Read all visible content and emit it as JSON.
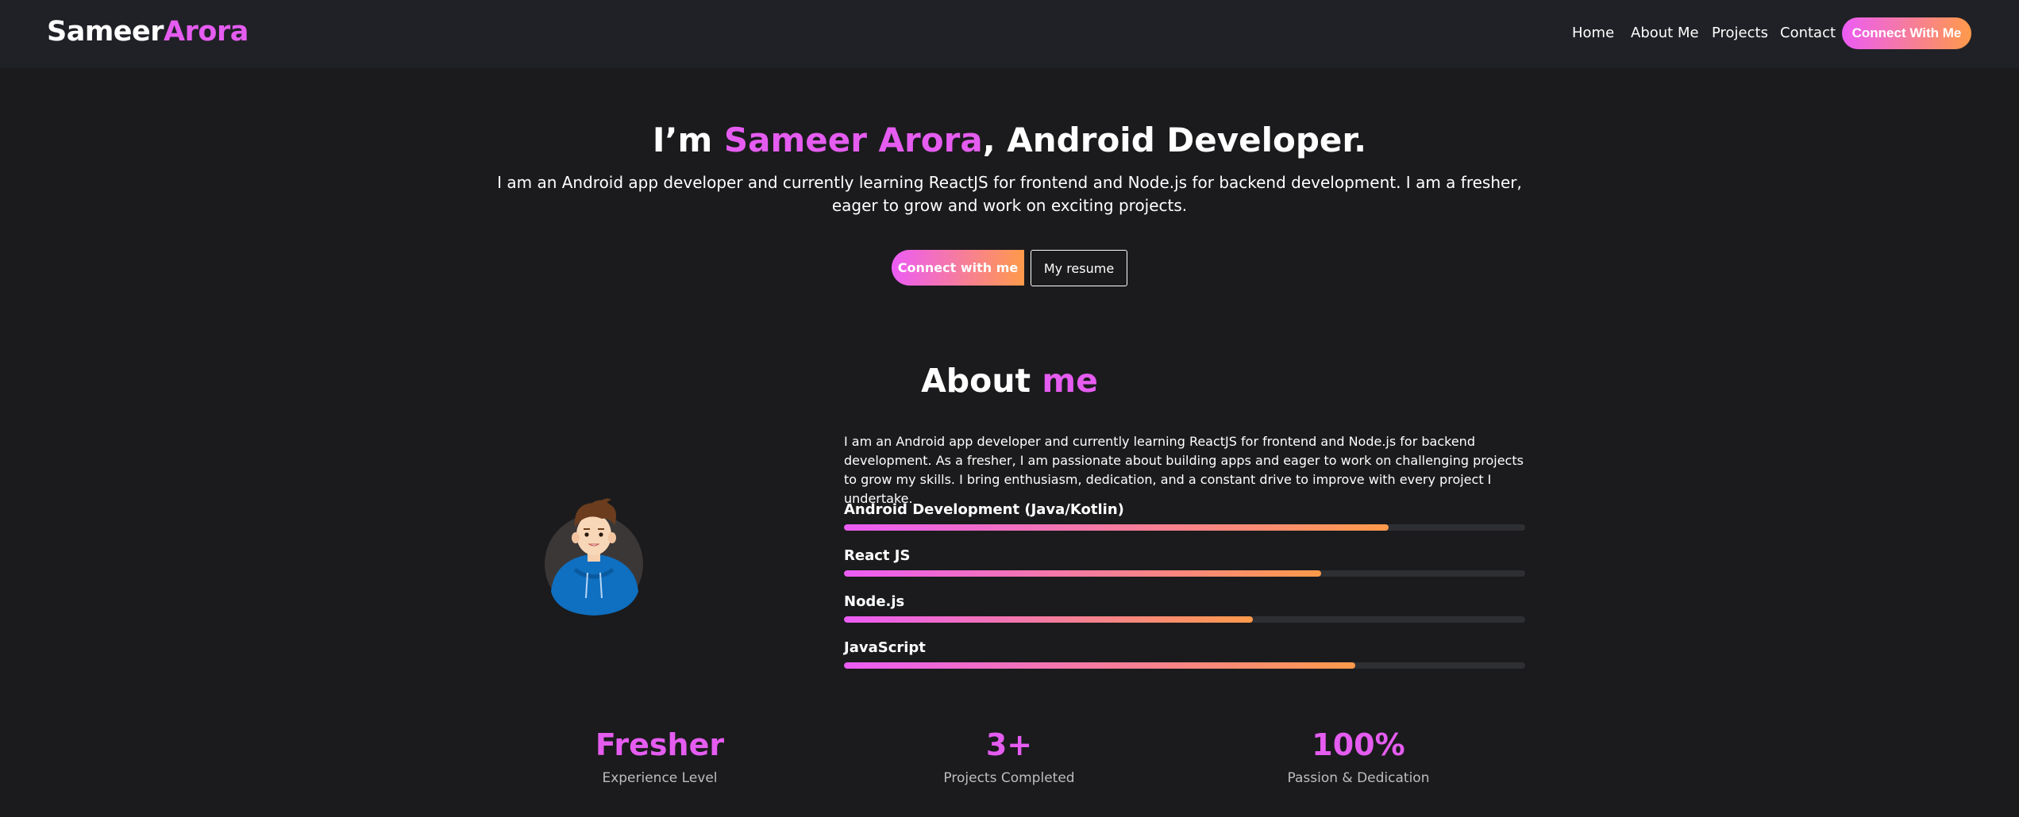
{
  "nav": {
    "logo_first": "Sameer",
    "logo_last": "Arora",
    "links": [
      "Home",
      "About Me",
      "Projects",
      "Contact"
    ],
    "cta_label": "Connect With Me"
  },
  "hero": {
    "title_prefix": "I’m ",
    "title_name": "Sameer Arora",
    "title_suffix": ", Android Developer.",
    "description": "I am an Android app developer and currently learning ReactJS for frontend and Node.js for backend development. I am a fresher, eager to grow and work on exciting projects.",
    "primary_button": "Connect with me",
    "secondary_button": "My resume"
  },
  "about": {
    "title_prefix": "About ",
    "title_accent": "me",
    "description": "I am an Android app developer and currently learning ReactJS for frontend and Node.js for backend development. As a fresher, I am passionate about building apps and eager to work on challenging projects to grow my skills. I bring enthusiasm, dedication, and a constant drive to improve with every project I undertake.",
    "skills": [
      {
        "name": "Android Development (Java/Kotlin)",
        "level": 0.8
      },
      {
        "name": "React JS",
        "level": 0.7
      },
      {
        "name": "Node.js",
        "level": 0.6
      },
      {
        "name": "JavaScript",
        "level": 0.75
      }
    ]
  },
  "stats": [
    {
      "value": "Fresher",
      "label": "Experience Level"
    },
    {
      "value": "3+",
      "label": "Projects Completed"
    },
    {
      "value": "100%",
      "label": "Passion & Dedication"
    }
  ],
  "colors": {
    "accent": "#e55cf0",
    "gradient_start": "#ec5cf5",
    "gradient_end": "#ff9a4a",
    "background": "#1b1b1d",
    "navbar": "#202126"
  }
}
